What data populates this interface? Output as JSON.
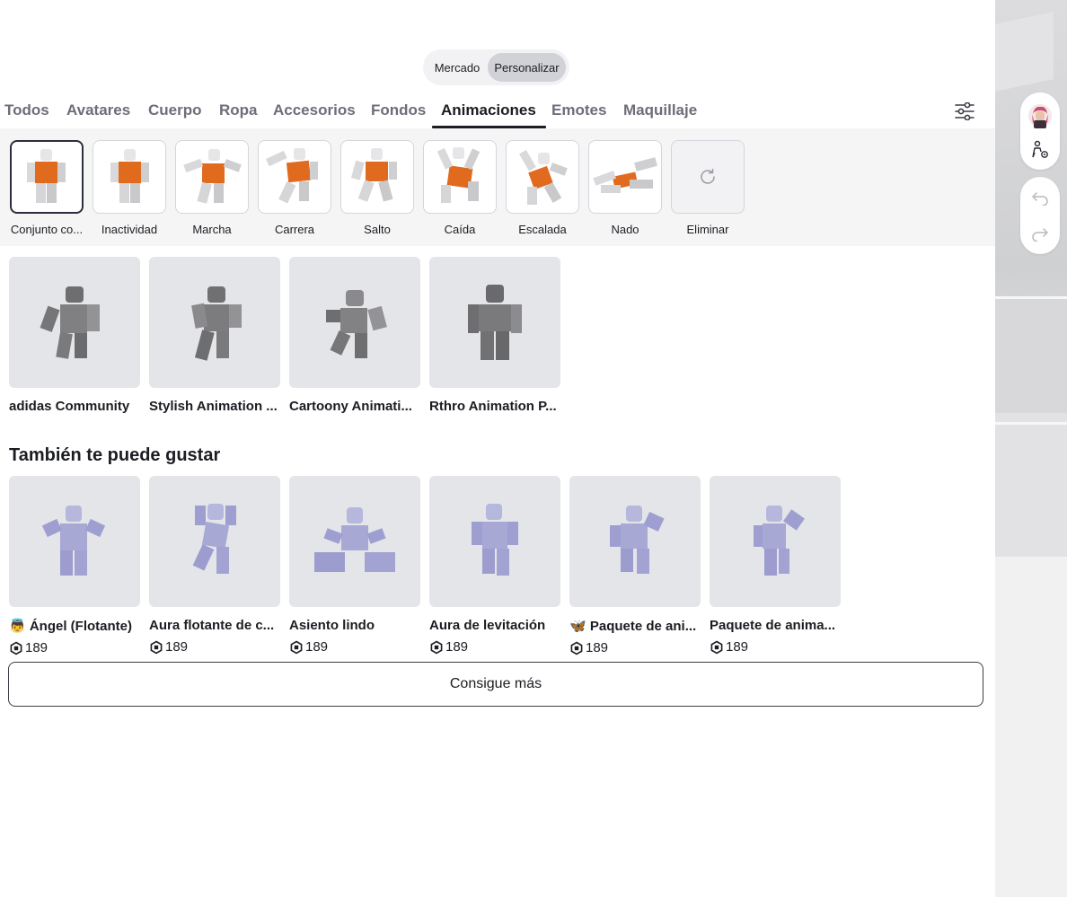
{
  "segment": {
    "market": "Mercado",
    "customize": "Personalizar"
  },
  "tabs": [
    {
      "label": "Todos",
      "active": false
    },
    {
      "label": "Avatares",
      "active": false
    },
    {
      "label": "Cuerpo",
      "active": false
    },
    {
      "label": "Ropa",
      "active": false
    },
    {
      "label": "Accesorios",
      "active": false
    },
    {
      "label": "Fondos",
      "active": false
    },
    {
      "label": "Animaciones",
      "active": true
    },
    {
      "label": "Emotes",
      "active": false
    },
    {
      "label": "Maquillaje",
      "active": false
    }
  ],
  "subcategories": [
    {
      "label": "Conjunto co...",
      "selected": true
    },
    {
      "label": "Inactividad"
    },
    {
      "label": "Marcha"
    },
    {
      "label": "Carrera"
    },
    {
      "label": "Salto"
    },
    {
      "label": "Caída"
    },
    {
      "label": "Escalada"
    },
    {
      "label": "Nado"
    },
    {
      "label": "Eliminar",
      "icon": "refresh-icon"
    }
  ],
  "owned": [
    {
      "name": "adidas Community"
    },
    {
      "name": "Stylish Animation ..."
    },
    {
      "name": "Cartoony Animati..."
    },
    {
      "name": "Rthro Animation P..."
    }
  ],
  "recommended_title": "También te puede gustar",
  "recommended": [
    {
      "name": "👼 Ángel (Flotante)",
      "price": "189"
    },
    {
      "name": "Aura flotante de c...",
      "price": "189"
    },
    {
      "name": "Asiento lindo",
      "price": "189"
    },
    {
      "name": "Aura de levitación",
      "price": "189"
    },
    {
      "name": "🦋 Paquete de ani...",
      "price": "189"
    },
    {
      "name": "Paquete de anima...",
      "price": "189"
    }
  ],
  "more_button": "Consigue más",
  "colors": {
    "text": "#1c1d22",
    "muted_tab": "#6c6e79",
    "card_bg": "#e4e5e9",
    "torso_orange": "#e06b1f",
    "robux_figure": "#a9aad6",
    "gray_figure": "#7a7a7c"
  },
  "icons": {
    "filter": "sliders-icon",
    "avatar": "avatar-thumbnail-icon",
    "avatar_settings": "person-gear-icon",
    "undo": "undo-icon",
    "redo": "redo-icon",
    "currency": "robux-icon"
  }
}
